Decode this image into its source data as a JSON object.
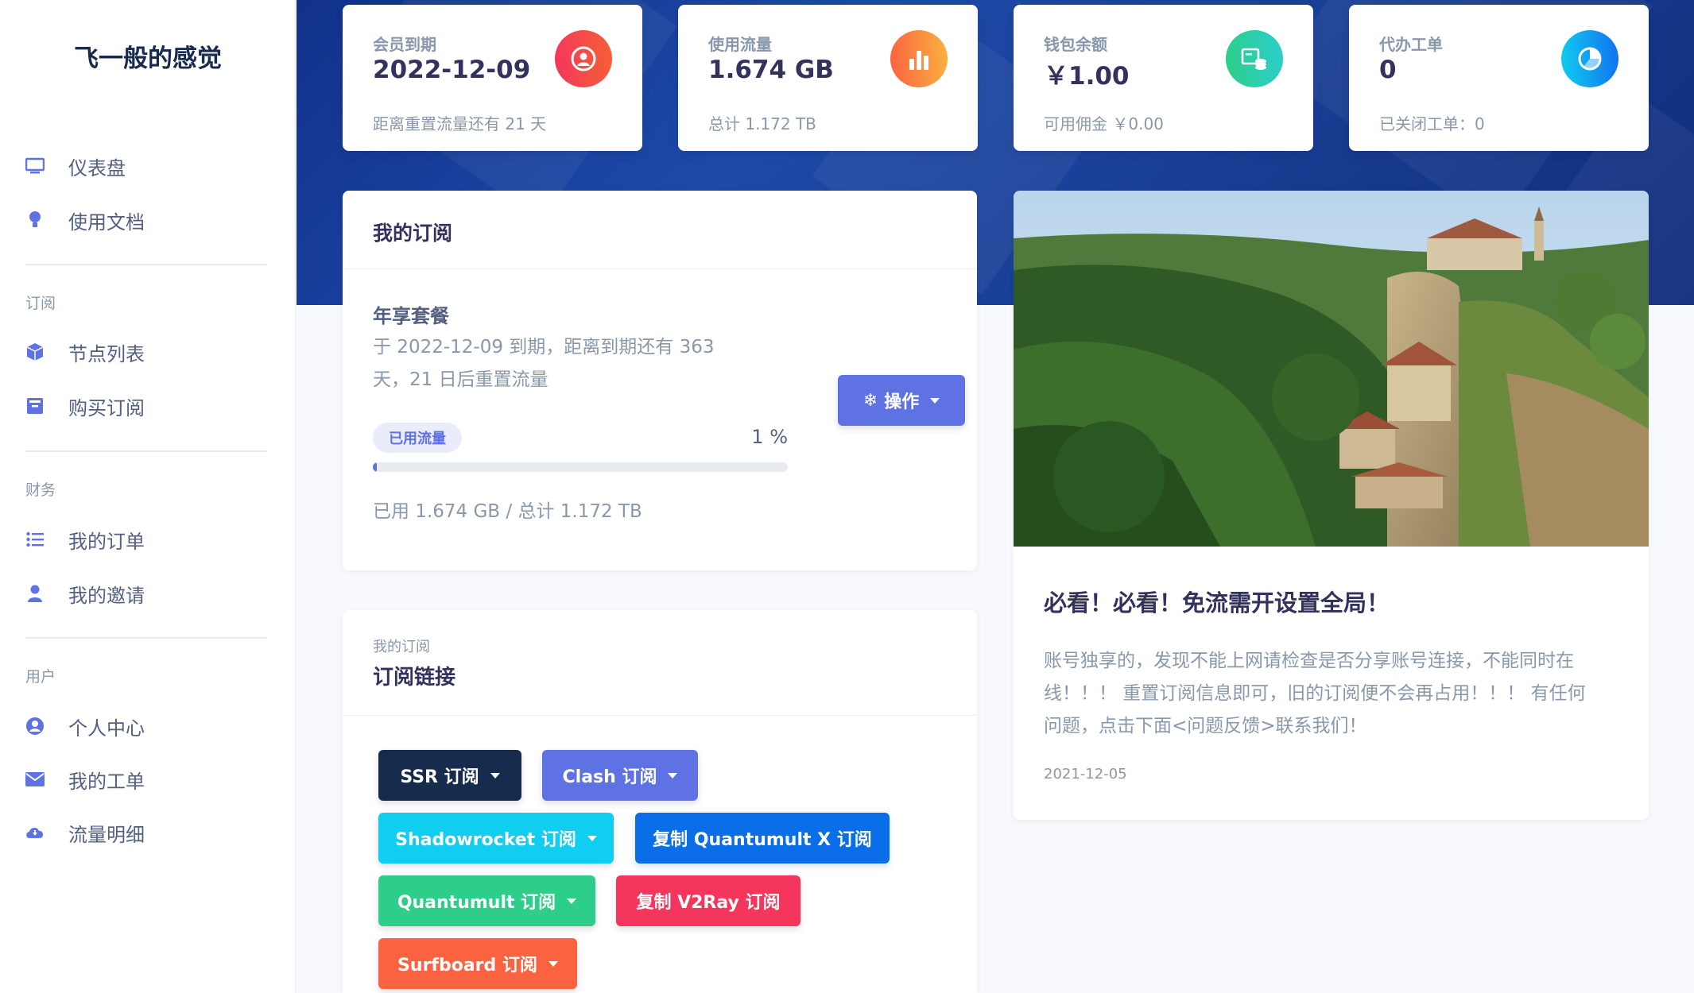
{
  "sidebar": {
    "brand": "飞一般的感觉",
    "items": [
      {
        "label": "仪表盘"
      },
      {
        "label": "使用文档"
      },
      {
        "label": "节点列表"
      },
      {
        "label": "购买订阅"
      },
      {
        "label": "我的订单"
      },
      {
        "label": "我的邀请"
      },
      {
        "label": "个人中心"
      },
      {
        "label": "我的工单"
      },
      {
        "label": "流量明细"
      }
    ],
    "sections": [
      "订阅",
      "财务",
      "用户"
    ]
  },
  "stats": [
    {
      "title": "会员到期",
      "value": "2022-12-09",
      "sub": "距离重置流量还有 21 天",
      "icon": "user-circle-icon",
      "color": "#f5365c"
    },
    {
      "title": "使用流量",
      "value": "1.674 GB",
      "sub": "总计 1.172 TB",
      "icon": "bar-chart-icon",
      "color": "#fb6340"
    },
    {
      "title": "钱包余额",
      "value": "￥1.00",
      "sub": "可用佣金 ￥0.00",
      "icon": "wallet-icon",
      "color": "#2dce89"
    },
    {
      "title": "代办工单",
      "value": "0",
      "sub": "已关闭工单：0",
      "icon": "pie-chart-icon",
      "color": "#11cdef"
    }
  ],
  "subscription": {
    "card_title": "我的订阅",
    "plan_name": "年享套餐",
    "plan_desc_line1": "于 2022-12-09 到期，距离到期还有 363",
    "plan_desc_line2": "天，21 日后重置流量",
    "usage_badge": "已用流量",
    "usage_percent_text": "1 %",
    "usage_percent": 1,
    "usage_detail": "已用 1.674 GB / 总计 1.172 TB",
    "action_button": "操作"
  },
  "links": {
    "subtitle": "我的订阅",
    "title": "订阅链接",
    "buttons": [
      {
        "label": "SSR 订阅",
        "color": "#172b4d",
        "dropdown": true
      },
      {
        "label": "Clash 订阅",
        "color": "#5e72e4",
        "dropdown": true
      },
      {
        "label": "Shadowrocket 订阅",
        "color": "#11cdef",
        "dropdown": true
      },
      {
        "label": "复制 Quantumult X 订阅",
        "color": "#0a6ee8",
        "dropdown": false
      },
      {
        "label": "Quantumult 订阅",
        "color": "#2dce89",
        "dropdown": true
      },
      {
        "label": "复制 V2Ray 订阅",
        "color": "#f5365c",
        "dropdown": false
      },
      {
        "label": "Surfboard 订阅",
        "color": "#fb6340",
        "dropdown": true
      }
    ]
  },
  "notice": {
    "title": "必看！必看！免流需开设置全局！",
    "body_line1": "账号独享的，发现不能上网请检查是否分享账号连接，不能同时在",
    "body_line2": "线！！！ 重置订阅信息即可，旧的订阅便不会再占用！！！ 有任何",
    "body_line3": "问题，点击下面<问题反馈>联系我们！",
    "date": "2021-12-05"
  }
}
